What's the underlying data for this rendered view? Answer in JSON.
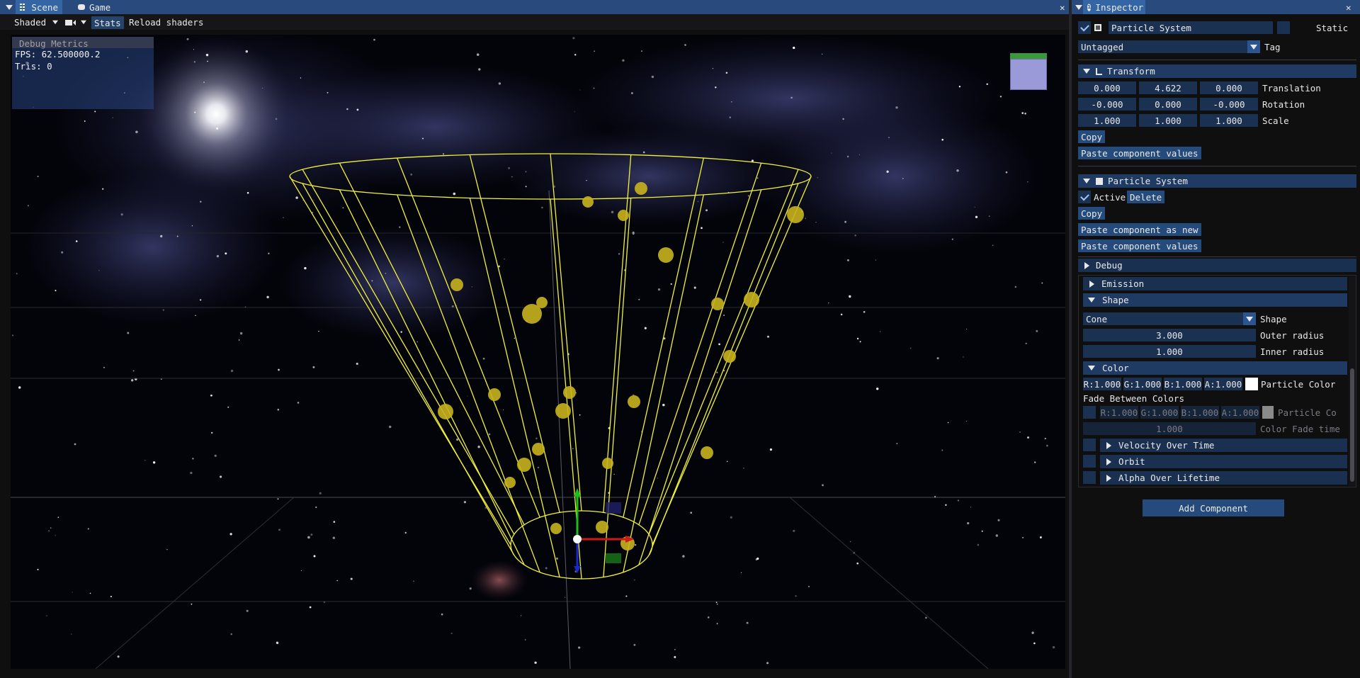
{
  "left_window": {
    "tabs": [
      {
        "label": "Scene",
        "icon": "grid-icon"
      },
      {
        "label": "Game",
        "icon": "gamepad-icon"
      }
    ],
    "close": "✕"
  },
  "toolbar": {
    "shading": "Shaded",
    "stats": "Stats",
    "reload": "Reload shaders"
  },
  "debug_metrics": {
    "title": "Debug Metrics",
    "fps": "FPS: 62.500000.2",
    "tris": "Tris: 0"
  },
  "inspector": {
    "tab": "Inspector",
    "close": "✕",
    "object_name": "Particle System",
    "static_label": "Static",
    "tag_value": "Untagged",
    "tag_label": "Tag",
    "transform": {
      "header": "Transform",
      "translation": [
        "0.000",
        "4.622",
        "0.000"
      ],
      "rotation": [
        "-0.000",
        "0.000",
        "-0.000"
      ],
      "scale": [
        "1.000",
        "1.000",
        "1.000"
      ],
      "translation_label": "Translation",
      "rotation_label": "Rotation",
      "scale_label": "Scale",
      "copy": "Copy",
      "paste_values": "Paste component values"
    },
    "particle_system": {
      "header": "Particle System",
      "active_label": "Active",
      "delete": "Delete",
      "copy": "Copy",
      "paste_new": "Paste component as new",
      "paste_values": "Paste component values"
    },
    "debug_header": "Debug",
    "emission_header": "Emission",
    "shape": {
      "header": "Shape",
      "shape_value": "Cone",
      "shape_label": "Shape",
      "outer_radius": "3.000",
      "outer_radius_label": "Outer radius",
      "inner_radius": "1.000",
      "inner_radius_label": "Inner radius"
    },
    "color": {
      "header": "Color",
      "r": "R:1.000",
      "g": "G:1.000",
      "b": "B:1.000",
      "a": "A:1.000",
      "particle_color_label": "Particle Color",
      "fade_label": "Fade Between Colors",
      "r2": "R:1.000",
      "g2": "G:1.000",
      "b2": "B:1.000",
      "a2": "A:1.000",
      "particle_color2_label": "Particle Co",
      "fade_time": "1.000",
      "fade_time_label": "Color Fade time"
    },
    "velocity_header": "Velocity Over Time",
    "orbit_header": "Orbit",
    "alpha_header": "Alpha Over Lifetime",
    "add_component": "Add Component"
  },
  "colors": {
    "title_bar": "#284a7c",
    "cone_wire": "#f2f23a",
    "particle": "#c8b21e",
    "gizmo_x": "#d01818",
    "gizmo_y": "#18c018",
    "gizmo_z": "#1828d0"
  }
}
